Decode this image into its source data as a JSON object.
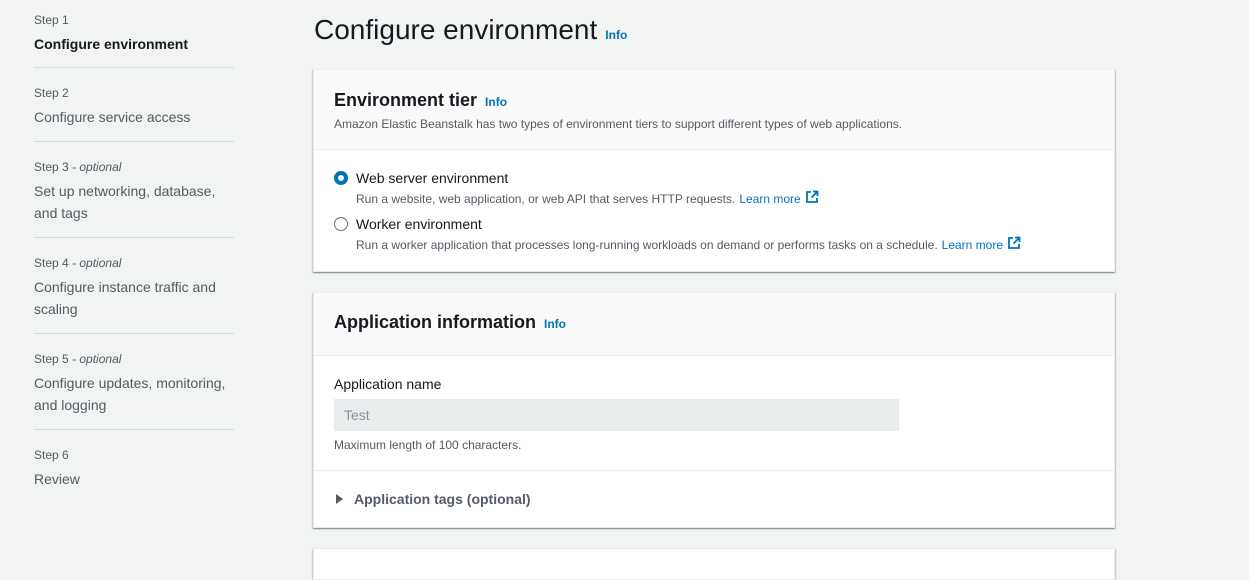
{
  "nav": {
    "steps": [
      {
        "label": "Step 1",
        "optional": "",
        "title": "Configure environment"
      },
      {
        "label": "Step 2",
        "optional": "",
        "title": "Configure service access"
      },
      {
        "label": "Step 3",
        "optional": " - optional",
        "title": "Set up networking, database, and tags"
      },
      {
        "label": "Step 4",
        "optional": " - optional",
        "title": "Configure instance traffic and scaling"
      },
      {
        "label": "Step 5",
        "optional": " - optional",
        "title": "Configure updates, monitoring, and logging"
      },
      {
        "label": "Step 6",
        "optional": "",
        "title": "Review"
      }
    ]
  },
  "page": {
    "title": "Configure environment",
    "info": "Info"
  },
  "env_tier": {
    "title": "Environment tier",
    "info": "Info",
    "description": "Amazon Elastic Beanstalk has two types of environment tiers to support different types of web applications.",
    "options": [
      {
        "label": "Web server environment",
        "desc": "Run a website, web application, or web API that serves HTTP requests.",
        "link": "Learn more",
        "checked": true
      },
      {
        "label": "Worker environment",
        "desc": "Run a worker application that processes long-running workloads on demand or performs tasks on a schedule.",
        "link": "Learn more",
        "checked": false
      }
    ]
  },
  "app_info": {
    "title": "Application information",
    "info": "Info",
    "name_label": "Application name",
    "name_value": "Test",
    "hint": "Maximum length of 100 characters.",
    "tags_label": "Application tags (optional)"
  },
  "colors": {
    "accent": "#0073bb",
    "background": "#f2f3f3"
  }
}
